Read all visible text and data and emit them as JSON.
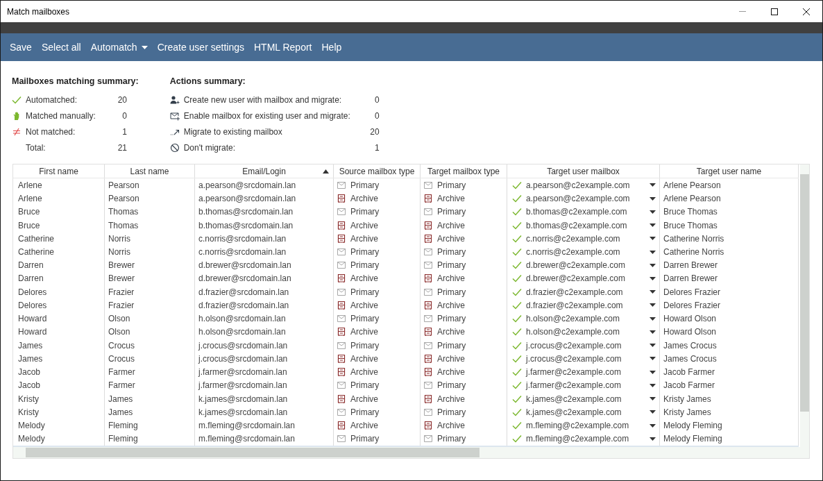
{
  "window": {
    "title": "Match mailboxes"
  },
  "toolbar": [
    {
      "label": "Save",
      "kind": "plain"
    },
    {
      "label": "Select all",
      "kind": "plain"
    },
    {
      "label": "Automatch",
      "kind": "dropdown"
    },
    {
      "label": "Create user settings",
      "kind": "plain"
    },
    {
      "label": "HTML Report",
      "kind": "plain"
    },
    {
      "label": "Help",
      "kind": "plain"
    }
  ],
  "matching_summary": {
    "title": "Mailboxes matching summary:",
    "items": [
      {
        "kind": "check",
        "label": "Automatched:",
        "value": "20"
      },
      {
        "kind": "hand",
        "label": "Matched manually:",
        "value": "0"
      },
      {
        "kind": "notequal",
        "label": "Not matched:",
        "value": "1"
      },
      {
        "kind": "none",
        "label": "Total:",
        "value": "21"
      }
    ]
  },
  "actions_summary": {
    "title": "Actions summary:",
    "items": [
      {
        "kind": "adduser",
        "label": "Create new user with mailbox and migrate:",
        "value": "0"
      },
      {
        "kind": "addmail",
        "label": "Enable mailbox for existing user and migrate:",
        "value": "0"
      },
      {
        "kind": "migrate",
        "label": "Migrate to existing mailbox",
        "value": "20"
      },
      {
        "kind": "forbid",
        "label": "Don't migrate:",
        "value": "1"
      }
    ]
  },
  "table": {
    "columns": [
      {
        "label": "First name",
        "sorted": false
      },
      {
        "label": "Last name",
        "sorted": false
      },
      {
        "label": "Email/Login",
        "sorted": true
      },
      {
        "label": "Source mailbox type",
        "sorted": false
      },
      {
        "label": "Target mailbox type",
        "sorted": false
      },
      {
        "label": "Target user mailbox",
        "sorted": false
      },
      {
        "label": "Target user name",
        "sorted": false
      }
    ],
    "rows": [
      {
        "first": "Arlene",
        "last": "Pearson",
        "email": "a.pearson@srcdomain.lan",
        "source": {
          "kind": "primary",
          "label": "Primary"
        },
        "target": {
          "kind": "primary",
          "label": "Primary"
        },
        "matched": true,
        "mailbox": "a.pearson@c2example.com",
        "name": "Arlene Pearson"
      },
      {
        "first": "Arlene",
        "last": "Pearson",
        "email": "a.pearson@srcdomain.lan",
        "source": {
          "kind": "archive",
          "label": "Archive"
        },
        "target": {
          "kind": "archive",
          "label": "Archive"
        },
        "matched": true,
        "mailbox": "a.pearson@c2example.com",
        "name": "Arlene Pearson"
      },
      {
        "first": "Bruce",
        "last": "Thomas",
        "email": "b.thomas@srcdomain.lan",
        "source": {
          "kind": "primary",
          "label": "Primary"
        },
        "target": {
          "kind": "primary",
          "label": "Primary"
        },
        "matched": true,
        "mailbox": "b.thomas@c2example.com",
        "name": "Bruce Thomas"
      },
      {
        "first": "Bruce",
        "last": "Thomas",
        "email": "b.thomas@srcdomain.lan",
        "source": {
          "kind": "archive",
          "label": "Archive"
        },
        "target": {
          "kind": "archive",
          "label": "Archive"
        },
        "matched": true,
        "mailbox": "b.thomas@c2example.com",
        "name": "Bruce Thomas"
      },
      {
        "first": "Catherine",
        "last": "Norris",
        "email": "c.norris@srcdomain.lan",
        "source": {
          "kind": "archive",
          "label": "Archive"
        },
        "target": {
          "kind": "archive",
          "label": "Archive"
        },
        "matched": true,
        "mailbox": "c.norris@c2example.com",
        "name": "Catherine Norris"
      },
      {
        "first": "Catherine",
        "last": "Norris",
        "email": "c.norris@srcdomain.lan",
        "source": {
          "kind": "primary",
          "label": "Primary"
        },
        "target": {
          "kind": "primary",
          "label": "Primary"
        },
        "matched": true,
        "mailbox": "c.norris@c2example.com",
        "name": "Catherine Norris"
      },
      {
        "first": "Darren",
        "last": "Brewer",
        "email": "d.brewer@srcdomain.lan",
        "source": {
          "kind": "primary",
          "label": "Primary"
        },
        "target": {
          "kind": "primary",
          "label": "Primary"
        },
        "matched": true,
        "mailbox": "d.brewer@c2example.com",
        "name": "Darren Brewer"
      },
      {
        "first": "Darren",
        "last": "Brewer",
        "email": "d.brewer@srcdomain.lan",
        "source": {
          "kind": "archive",
          "label": "Archive"
        },
        "target": {
          "kind": "archive",
          "label": "Archive"
        },
        "matched": true,
        "mailbox": "d.brewer@c2example.com",
        "name": "Darren Brewer"
      },
      {
        "first": "Delores",
        "last": "Frazier",
        "email": "d.frazier@srcdomain.lan",
        "source": {
          "kind": "primary",
          "label": "Primary"
        },
        "target": {
          "kind": "primary",
          "label": "Primary"
        },
        "matched": true,
        "mailbox": "d.frazier@c2example.com",
        "name": "Delores Frazier"
      },
      {
        "first": "Delores",
        "last": "Frazier",
        "email": "d.frazier@srcdomain.lan",
        "source": {
          "kind": "archive",
          "label": "Archive"
        },
        "target": {
          "kind": "archive",
          "label": "Archive"
        },
        "matched": true,
        "mailbox": "d.frazier@c2example.com",
        "name": "Delores Frazier"
      },
      {
        "first": "Howard",
        "last": "Olson",
        "email": "h.olson@srcdomain.lan",
        "source": {
          "kind": "primary",
          "label": "Primary"
        },
        "target": {
          "kind": "primary",
          "label": "Primary"
        },
        "matched": true,
        "mailbox": "h.olson@c2example.com",
        "name": "Howard Olson"
      },
      {
        "first": "Howard",
        "last": "Olson",
        "email": "h.olson@srcdomain.lan",
        "source": {
          "kind": "archive",
          "label": "Archive"
        },
        "target": {
          "kind": "archive",
          "label": "Archive"
        },
        "matched": true,
        "mailbox": "h.olson@c2example.com",
        "name": "Howard Olson"
      },
      {
        "first": "James",
        "last": "Crocus",
        "email": "j.crocus@srcdomain.lan",
        "source": {
          "kind": "primary",
          "label": "Primary"
        },
        "target": {
          "kind": "primary",
          "label": "Primary"
        },
        "matched": true,
        "mailbox": "j.crocus@c2example.com",
        "name": "James Crocus"
      },
      {
        "first": "James",
        "last": "Crocus",
        "email": "j.crocus@srcdomain.lan",
        "source": {
          "kind": "archive",
          "label": "Archive"
        },
        "target": {
          "kind": "archive",
          "label": "Archive"
        },
        "matched": true,
        "mailbox": "j.crocus@c2example.com",
        "name": "James Crocus"
      },
      {
        "first": "Jacob",
        "last": "Farmer",
        "email": "j.farmer@srcdomain.lan",
        "source": {
          "kind": "archive",
          "label": "Archive"
        },
        "target": {
          "kind": "archive",
          "label": "Archive"
        },
        "matched": true,
        "mailbox": "j.farmer@c2example.com",
        "name": "Jacob Farmer"
      },
      {
        "first": "Jacob",
        "last": "Farmer",
        "email": "j.farmer@srcdomain.lan",
        "source": {
          "kind": "primary",
          "label": "Primary"
        },
        "target": {
          "kind": "primary",
          "label": "Primary"
        },
        "matched": true,
        "mailbox": "j.farmer@c2example.com",
        "name": "Jacob Farmer"
      },
      {
        "first": "Kristy",
        "last": "James",
        "email": "k.james@srcdomain.lan",
        "source": {
          "kind": "archive",
          "label": "Archive"
        },
        "target": {
          "kind": "archive",
          "label": "Archive"
        },
        "matched": true,
        "mailbox": "k.james@c2example.com",
        "name": "Kristy James"
      },
      {
        "first": "Kristy",
        "last": "James",
        "email": "k.james@srcdomain.lan",
        "source": {
          "kind": "primary",
          "label": "Primary"
        },
        "target": {
          "kind": "primary",
          "label": "Primary"
        },
        "matched": true,
        "mailbox": "k.james@c2example.com",
        "name": "Kristy James"
      },
      {
        "first": "Melody",
        "last": "Fleming",
        "email": "m.fleming@srcdomain.lan",
        "source": {
          "kind": "archive",
          "label": "Archive"
        },
        "target": {
          "kind": "archive",
          "label": "Archive"
        },
        "matched": true,
        "mailbox": "m.fleming@c2example.com",
        "name": "Melody Fleming"
      },
      {
        "first": "Melody",
        "last": "Fleming",
        "email": "m.fleming@srcdomain.lan",
        "source": {
          "kind": "primary",
          "label": "Primary"
        },
        "target": {
          "kind": "primary",
          "label": "Primary"
        },
        "matched": true,
        "mailbox": "m.fleming@c2example.com",
        "name": "Melody Fleming"
      }
    ]
  }
}
